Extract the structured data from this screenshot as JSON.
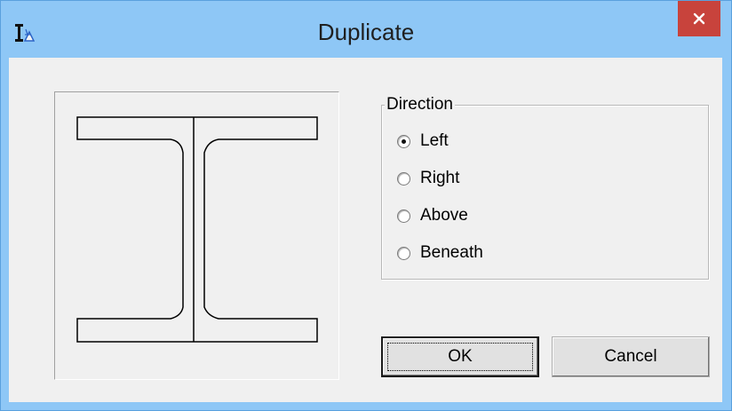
{
  "window": {
    "title": "Duplicate",
    "app_icon": "ibeam-app-icon",
    "close_icon": "close-icon"
  },
  "preview": {
    "icon": "ibeam-section-preview"
  },
  "direction": {
    "label": "Direction",
    "options": [
      {
        "label": "Left",
        "checked": true
      },
      {
        "label": "Right",
        "checked": false
      },
      {
        "label": "Above",
        "checked": false
      },
      {
        "label": "Beneath",
        "checked": false
      }
    ]
  },
  "buttons": {
    "ok": "OK",
    "cancel": "Cancel"
  }
}
